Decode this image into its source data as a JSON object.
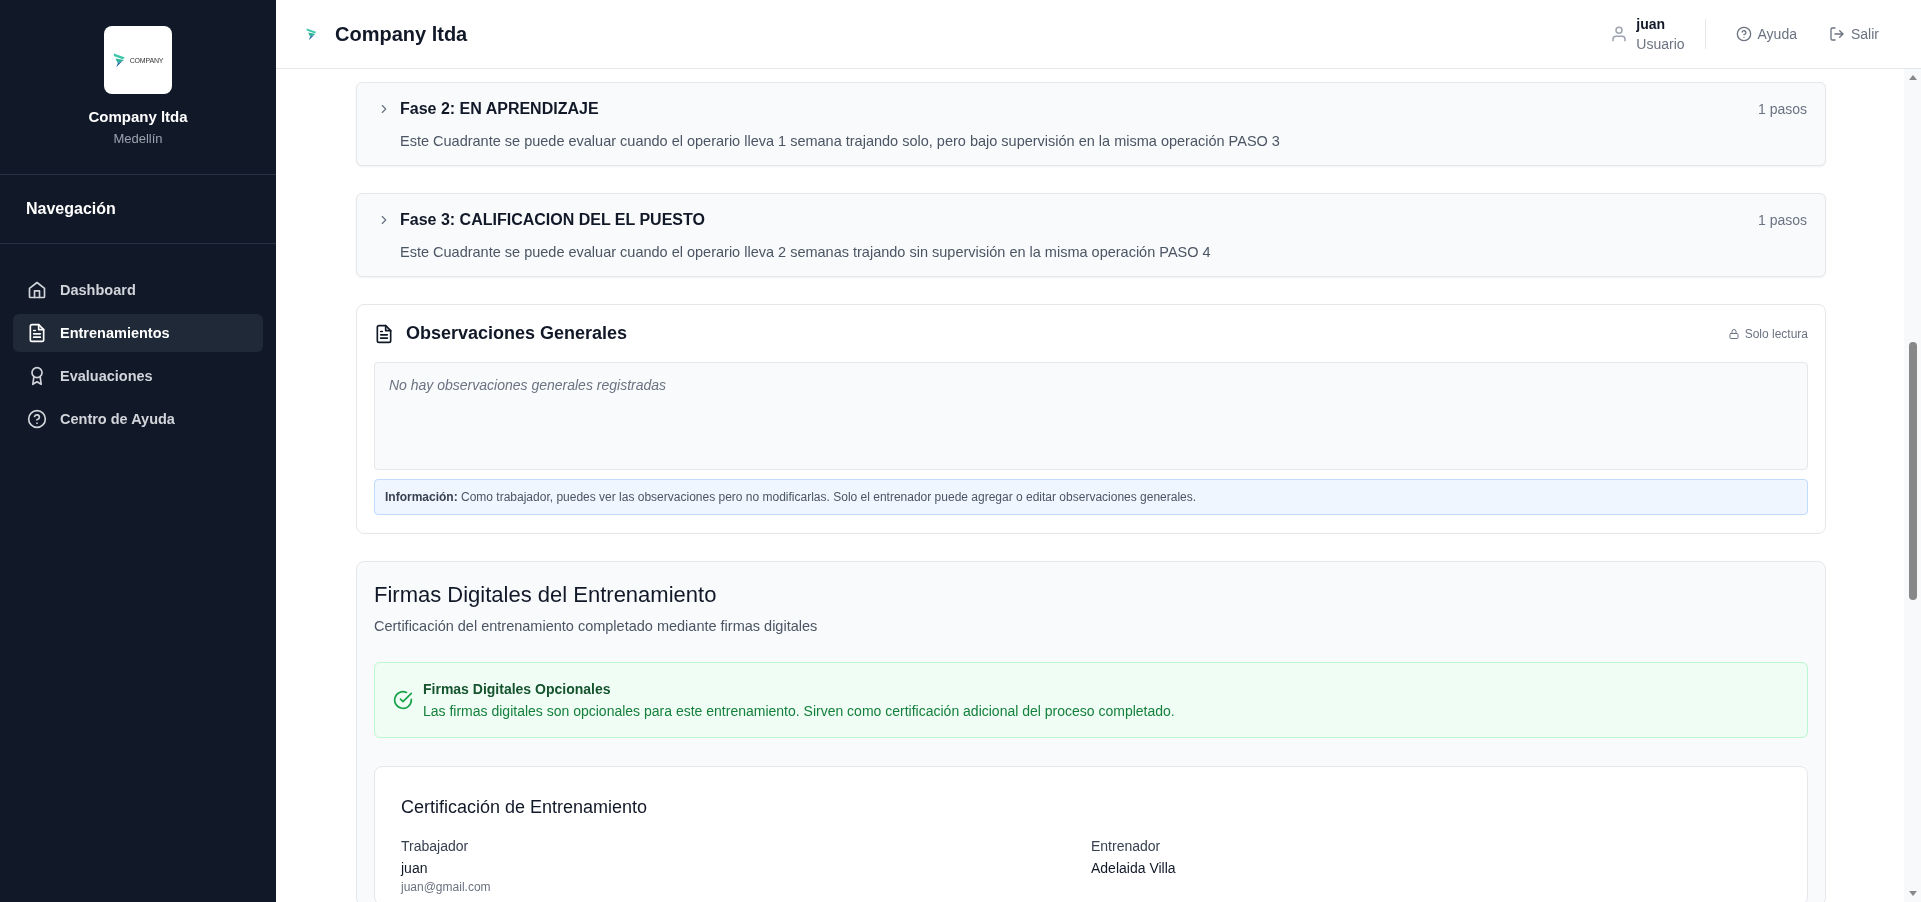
{
  "sidebar": {
    "logo_text": "COMPANY",
    "company": "Company ltda",
    "city": "Medellín",
    "nav_title": "Navegación",
    "items": [
      {
        "label": "Dashboard",
        "selected": false
      },
      {
        "label": "Entrenamientos",
        "selected": true
      },
      {
        "label": "Evaluaciones",
        "selected": false
      },
      {
        "label": "Centro de Ayuda",
        "selected": false
      }
    ]
  },
  "header": {
    "title": "Company ltda",
    "user_name": "juan",
    "user_role": "Usuario",
    "help": "Ayuda",
    "logout": "Salir"
  },
  "phases": [
    {
      "title": "Fase 2: EN APRENDIZAJE",
      "description": "Este Cuadrante se puede evaluar cuando el operario lleva 1 semana trajando solo, pero bajo supervisión en la misma operación PASO 3",
      "steps": "1 pasos",
      "expanded": false
    },
    {
      "title": "Fase 3: CALIFICACION DEL EL PUESTO",
      "description": "Este Cuadrante se puede evaluar cuando el operario lleva 2 semanas trajando sin supervisión en la misma operación PASO 4",
      "steps": "1 pasos",
      "expanded": false
    }
  ],
  "observations": {
    "title": "Observaciones Generales",
    "mode": "Solo lectura",
    "placeholder": "No hay observaciones generales registradas",
    "info": "**Información:** Como trabajador, puedes ver las observaciones pero no modificarlas. Solo el entrenador puede agregar o editar observaciones generales."
  },
  "signatures": {
    "title": "Firmas Digitales del Entrenamiento",
    "subtitle": "Certificación del entrenamiento completado mediante firmas digitales",
    "alert": {
      "title": "Firmas Digitales Opcionales",
      "text": "Las firmas digitales son opcionales para este entrenamiento. Sirven como certificación adicional del proceso completado."
    },
    "certificate": {
      "title": "Certificación de Entrenamiento",
      "parties": [
        {
          "role": "Trabajador",
          "name": "juan",
          "email": "juan@gmail.com"
        },
        {
          "role": "Entrenador",
          "name": "Adelaida Villa"
        }
      ]
    }
  }
}
